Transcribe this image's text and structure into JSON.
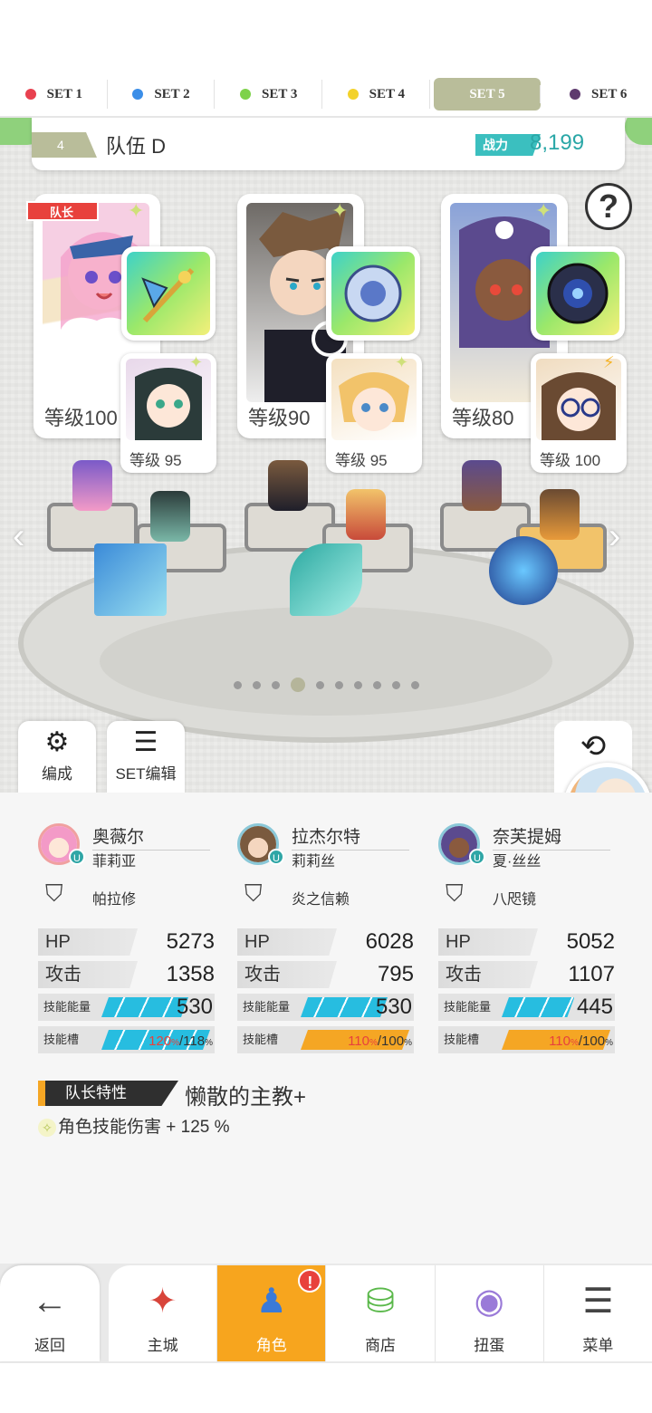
{
  "set_tabs": [
    {
      "label": "SET 1",
      "color": "#e8414f"
    },
    {
      "label": "SET 2",
      "color": "#3b8ee8"
    },
    {
      "label": "SET 3",
      "color": "#7ed24a"
    },
    {
      "label": "SET 4",
      "color": "#f3d22a"
    },
    {
      "label": "SET 5",
      "color": "#b9bd9a",
      "active": true
    },
    {
      "label": "SET 6",
      "color": "#5e3a6e"
    }
  ],
  "team": {
    "number": "4",
    "name": "队伍 D",
    "power_label": "战力",
    "power_value": "8,199"
  },
  "help_icon": "?",
  "leader_badge": "队长",
  "units": [
    {
      "level": "等级100",
      "sub_level": "等级 95"
    },
    {
      "level": "等级90",
      "sub_level": "等级 95"
    },
    {
      "level": "等级80",
      "sub_level": "等级 100"
    }
  ],
  "page_dots": {
    "count": 10,
    "current": 4
  },
  "side_buttons": {
    "formation": "编成",
    "set_edit": "SET编辑"
  },
  "characters": [
    {
      "name": "奥薇尔",
      "sub": "菲莉亚",
      "weapon": "帕拉修",
      "hp": "5273",
      "atk": "1358",
      "energy": "530",
      "energy_fill": 0.8,
      "slot_cur": "120",
      "slot_max": "/118",
      "slot_fill": 1.0
    },
    {
      "name": "拉杰尔特",
      "sub": "莉莉丝",
      "weapon": "炎之信赖",
      "hp": "6028",
      "atk": "795",
      "energy": "530",
      "energy_fill": 0.8,
      "slot_cur": "110",
      "slot_max": "/100",
      "slot_fill": 1.0
    },
    {
      "name": "奈芙提姆",
      "sub": "夏·丝丝",
      "weapon": "八咫镜",
      "hp": "5052",
      "atk": "1107",
      "energy": "445",
      "energy_fill": 0.67,
      "slot_cur": "110",
      "slot_max": "/100",
      "slot_fill": 1.0
    }
  ],
  "stat_labels": {
    "hp": "HP",
    "atk": "攻击",
    "energy": "技能能量",
    "slot": "技能槽",
    "percent": "%"
  },
  "leader_trait": {
    "label": "队长特性",
    "name": "懒散的主教+",
    "effect": "角色技能伤害 + 125 %"
  },
  "nav": {
    "back": "返回",
    "items": [
      "主城",
      "角色",
      "商店",
      "扭蛋",
      "菜单"
    ],
    "active": "角色",
    "alert": "!"
  }
}
